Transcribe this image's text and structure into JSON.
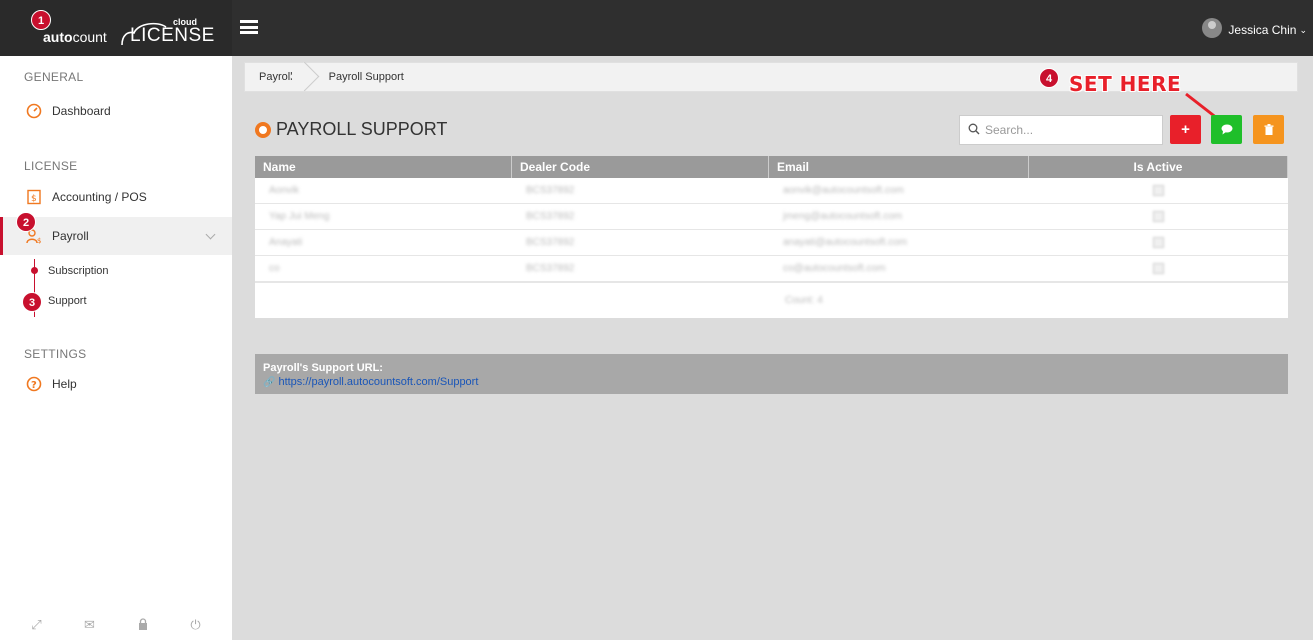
{
  "brand": {
    "prefix": "auto",
    "suffix": "count",
    "cloud": "cloud",
    "product": "LICENSE"
  },
  "user": {
    "name": "Jessica Chin"
  },
  "sidebar": {
    "sections": [
      {
        "title": "GENERAL",
        "items": [
          {
            "label": "Dashboard",
            "icon": "speedometer-icon"
          }
        ]
      },
      {
        "title": "LICENSE",
        "items": [
          {
            "label": "Accounting / POS",
            "icon": "dollar-doc-icon"
          },
          {
            "label": "Payroll",
            "icon": "user-dollar-icon",
            "active": true,
            "children": [
              {
                "label": "Subscription"
              },
              {
                "label": "Support"
              }
            ]
          }
        ]
      },
      {
        "title": "SETTINGS",
        "items": [
          {
            "label": "Help",
            "icon": "question-circle-icon"
          }
        ]
      }
    ],
    "footer_icons": [
      "expand-icon",
      "mail-icon",
      "lock-icon",
      "power-icon"
    ]
  },
  "breadcrumb": [
    "Payroll",
    "Payroll Support"
  ],
  "page": {
    "title": "PAYROLL SUPPORT",
    "search_placeholder": "Search..."
  },
  "toolbar": {
    "add_label": "+",
    "annotation_label": "SET HERE"
  },
  "markers": [
    "1",
    "2",
    "3",
    "4"
  ],
  "table": {
    "columns": [
      "Name",
      "Dealer Code",
      "Email",
      "Is Active"
    ],
    "rows": [
      [
        "Aonvik",
        "BCS37892",
        "aonvik@autocountsoft.com"
      ],
      [
        "Yap Jui Meng",
        "BCS37892",
        "jmeng@autocountsoft.com"
      ],
      [
        "Anayati",
        "BCS37892",
        "anayati@autocountsoft.com"
      ],
      [
        "co",
        "BCS37892",
        "co@autocountsoft.com"
      ]
    ],
    "footer": "Count: 4"
  },
  "support_url": {
    "title": "Payroll's Support URL:",
    "url": "https://payroll.autocountsoft.com/Support"
  },
  "colors": {
    "accent": "#c8102e",
    "add": "#e8202a",
    "chat": "#1fbf2a",
    "delete": "#f5941e"
  }
}
